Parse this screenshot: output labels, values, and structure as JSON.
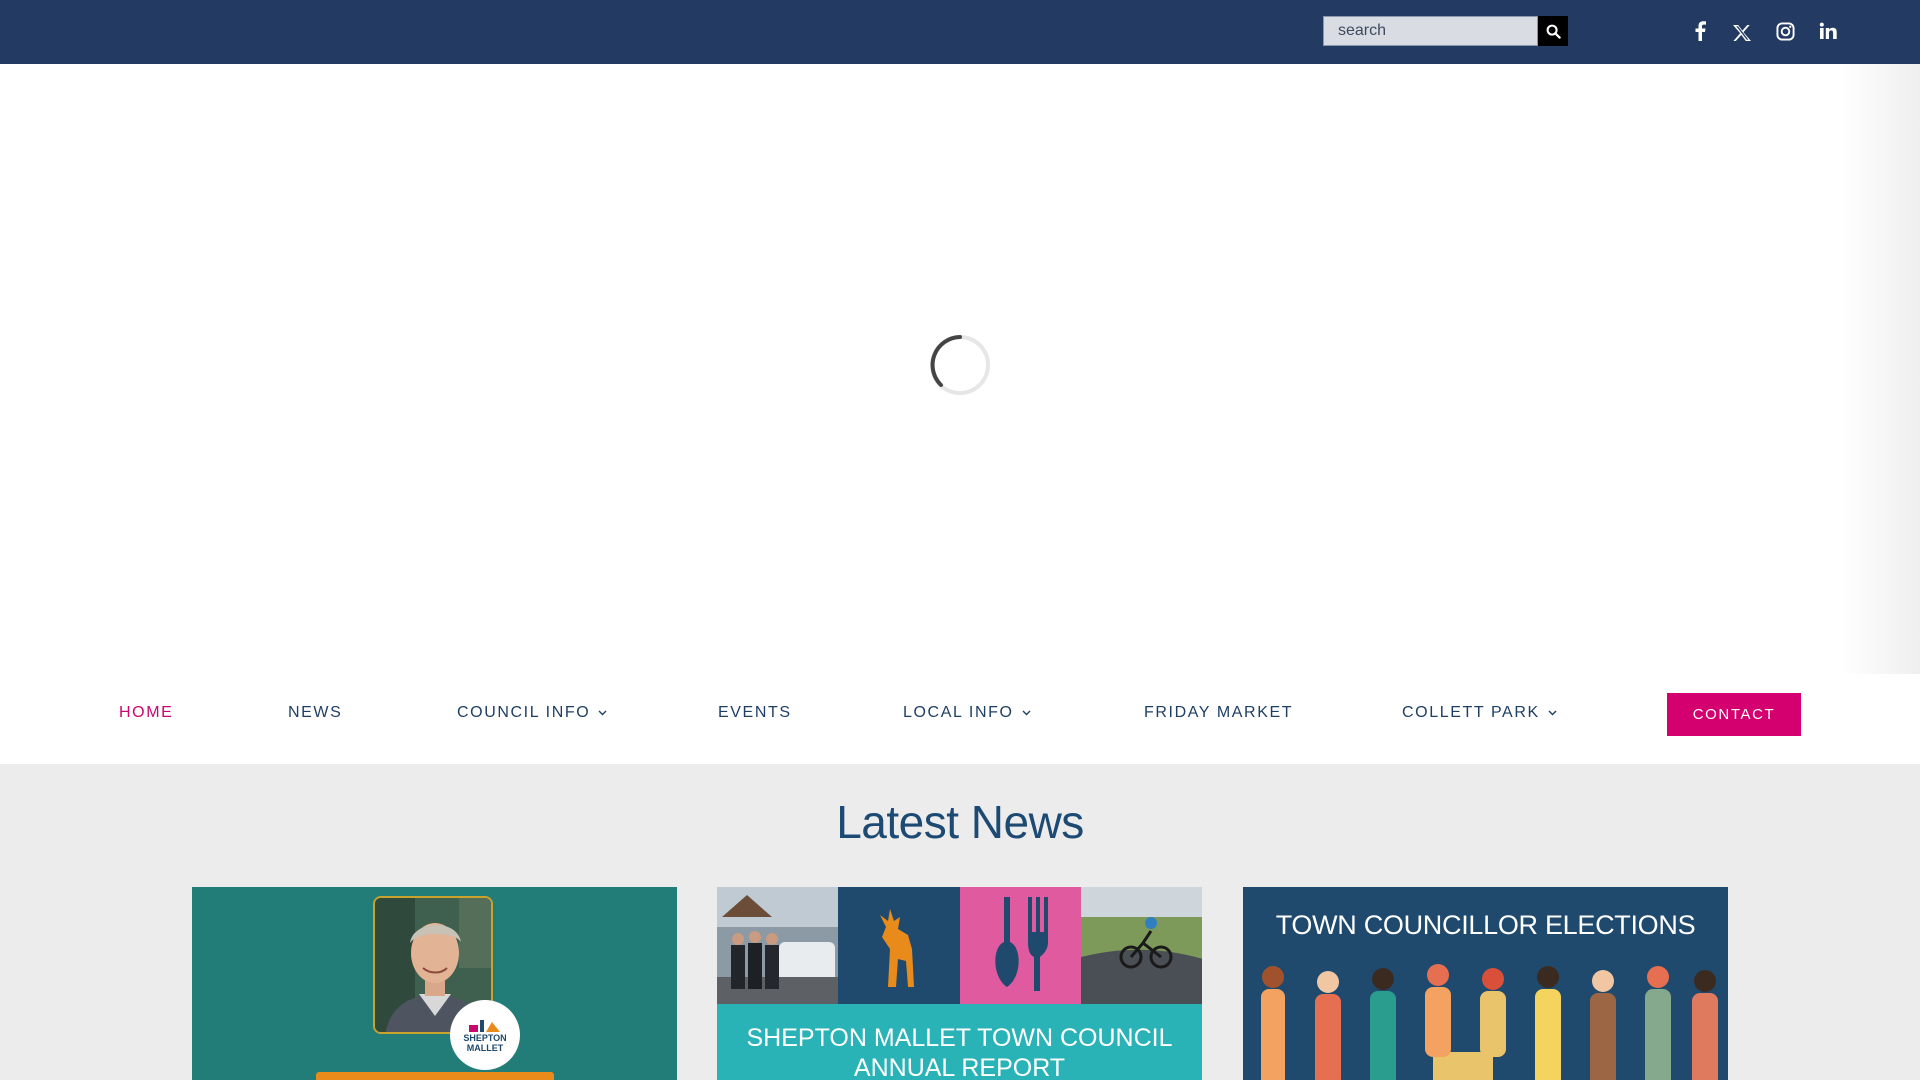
{
  "topbar": {
    "search_placeholder": "search",
    "social": [
      "facebook-icon",
      "x-icon",
      "instagram-icon",
      "linkedin-icon"
    ],
    "background": "#233b63"
  },
  "nav": {
    "items": [
      {
        "label": "HOME",
        "active": true,
        "dropdown": false
      },
      {
        "label": "NEWS",
        "active": false,
        "dropdown": false
      },
      {
        "label": "COUNCIL INFO",
        "active": false,
        "dropdown": true
      },
      {
        "label": "EVENTS",
        "active": false,
        "dropdown": false
      },
      {
        "label": "LOCAL INFO",
        "active": false,
        "dropdown": true
      },
      {
        "label": "FRIDAY MARKET",
        "active": false,
        "dropdown": false
      },
      {
        "label": "COLLETT PARK",
        "active": false,
        "dropdown": true
      }
    ],
    "contact_label": "CONTACT",
    "accent": "#d4006f",
    "text_color": "#1e3f63"
  },
  "news": {
    "title": "Latest News",
    "cards": [
      {
        "logo_line1": "SHEPTON",
        "logo_line2": "MALLET"
      },
      {
        "line1": "SHEPTON MALLET TOWN COUNCIL",
        "line2": "ANNUAL REPORT"
      },
      {
        "title": "TOWN COUNCILLOR ELECTIONS"
      }
    ]
  }
}
